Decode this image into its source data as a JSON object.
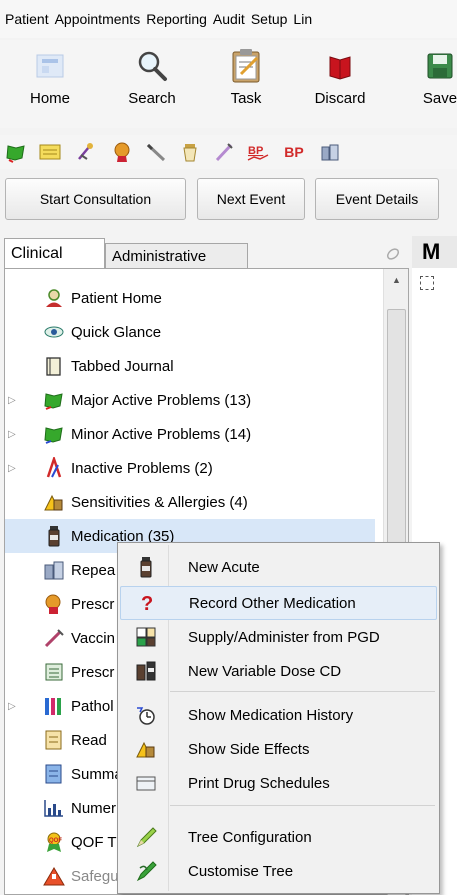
{
  "menubar": {
    "items": [
      "Patient",
      "Appointments",
      "Reporting",
      "Audit",
      "Setup",
      "Lin"
    ]
  },
  "toolbar": {
    "buttons": [
      {
        "label": "Home",
        "icon": "home-icon"
      },
      {
        "label": "Search",
        "icon": "magnifier-icon"
      },
      {
        "label": "Task",
        "icon": "clipboard-icon"
      },
      {
        "label": "Discard",
        "icon": "discard-book-icon"
      },
      {
        "label": "Save",
        "icon": "floppy-disk-icon"
      }
    ]
  },
  "iconbar": {
    "icons": [
      "problem-book-icon",
      "envelope-icon",
      "bp-tool-icon",
      "allergy-icon",
      "pen-icon",
      "bottle-icon",
      "syringe-icon",
      "bp-chart-icon",
      "bp-icon",
      "repeat-meds-icon"
    ],
    "bp_label": "BP"
  },
  "actions": {
    "start": "Start Consultation",
    "next": "Next Event",
    "details": "Event Details"
  },
  "tabs": {
    "clinical": "Clinical",
    "administrative": "Administrative"
  },
  "tree": {
    "items": [
      {
        "label": "Patient Home",
        "icon": "patient-home-icon"
      },
      {
        "label": "Quick Glance",
        "icon": "quick-glance-icon"
      },
      {
        "label": "Tabbed Journal",
        "icon": "journal-icon"
      },
      {
        "label": "Major Active Problems (13)",
        "icon": "major-problems-icon"
      },
      {
        "label": "Minor Active Problems (14)",
        "icon": "minor-problems-icon"
      },
      {
        "label": "Inactive Problems (2)",
        "icon": "inactive-problems-icon"
      },
      {
        "label": "Sensitivities & Allergies (4)",
        "icon": "allergy-icon"
      },
      {
        "label": "Medication (35)",
        "icon": "medication-bottle-icon"
      },
      {
        "label": "Repea",
        "icon": "repeat-templates-icon"
      },
      {
        "label": "Prescr",
        "icon": "prescription-icon"
      },
      {
        "label": "Vaccin",
        "icon": "vaccination-icon"
      },
      {
        "label": "Prescr",
        "icon": "prescription-list-icon"
      },
      {
        "label": "Pathol",
        "icon": "pathology-icon"
      },
      {
        "label": "Read",
        "icon": "read-codes-icon"
      },
      {
        "label": "Summa",
        "icon": "summary-icon"
      },
      {
        "label": "Numer",
        "icon": "numerics-chart-icon"
      },
      {
        "label": "QOF T",
        "icon": "qof-icon"
      },
      {
        "label": "Safegu",
        "icon": "safeguarding-icon"
      }
    ]
  },
  "right_pane": {
    "title": "M"
  },
  "context_menu": {
    "items": [
      {
        "label": "New Acute",
        "icon": "medication-bottle-icon"
      },
      {
        "label": "Record Other Medication",
        "icon": "question-mark-icon"
      },
      {
        "label": "Supply/Administer from PGD",
        "icon": "pgd-icon"
      },
      {
        "label": "New Variable Dose CD",
        "icon": "variable-dose-icon"
      },
      {
        "label": "Show Medication History",
        "icon": "history-clock-icon"
      },
      {
        "label": "Show Side Effects",
        "icon": "side-effects-icon"
      },
      {
        "label": "Print Drug Schedules",
        "icon": "print-schedule-icon"
      },
      {
        "label": "Tree Configuration",
        "icon": "tree-config-icon"
      },
      {
        "label": "Customise Tree",
        "icon": "customise-tree-icon"
      }
    ]
  },
  "colors": {
    "selection": "#d8e7f8",
    "menu_hover": "#e6eef8",
    "menu_background": "#f1f1f1"
  }
}
